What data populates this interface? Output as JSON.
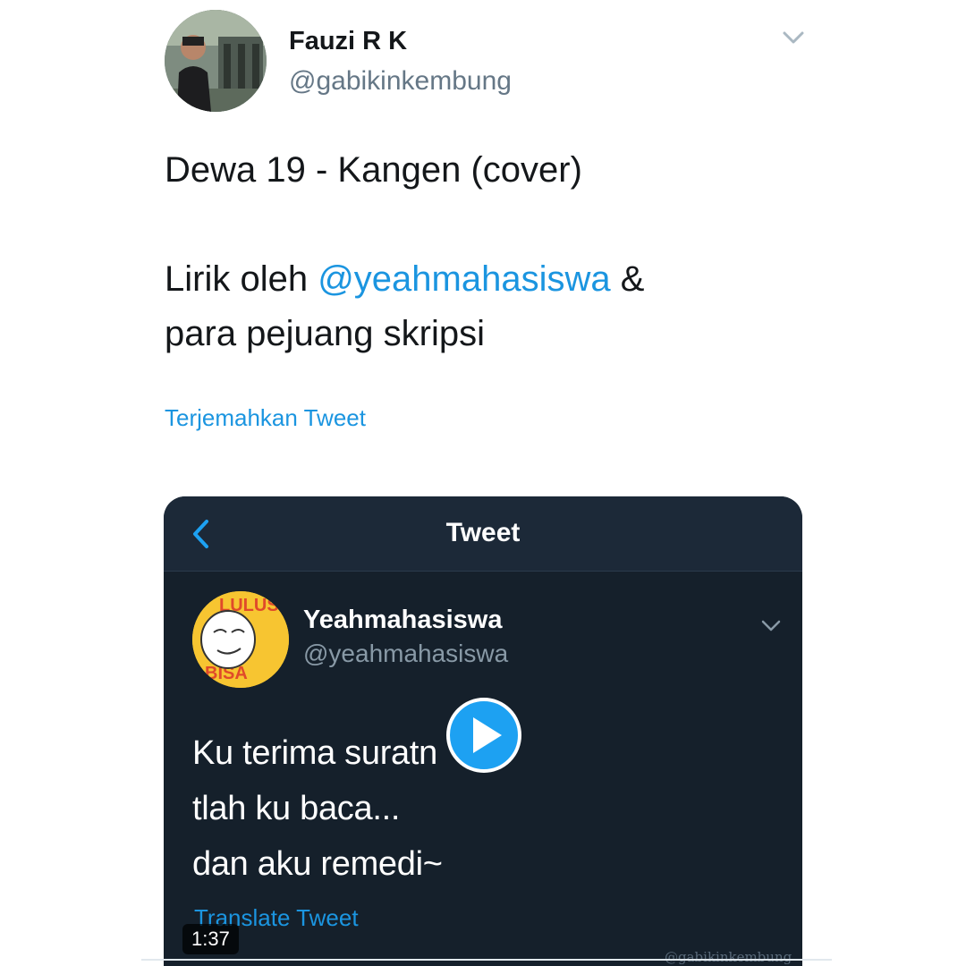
{
  "tweet": {
    "author": {
      "name": "Fauzi R K",
      "handle": "@gabikinkembung",
      "avatar_icon": "person-photo-avatar"
    },
    "menu_icon": "chevron-down-icon",
    "text": {
      "line1": "Dewa 19 - Kangen (cover)",
      "line2_prefix": "Lirik oleh ",
      "line2_mention": "@yeahmahasiswa",
      "line2_suffix": " &",
      "line3": "para pejuang skripsi"
    },
    "translate_label": "Terjemahkan Tweet",
    "accent_color": "#1b95e0"
  },
  "media": {
    "header_title": "Tweet",
    "back_icon": "chevron-left-icon",
    "embedded_tweet": {
      "name": "Yeahmahasiswa",
      "handle": "@yeahmahasiswa",
      "avatar_icon": "meme-face-avatar",
      "lines": [
        "Ku terima suratn",
        "tlah ku baca...",
        "dan aku remedi~"
      ],
      "translate_label": "Translate Tweet"
    },
    "play_icon": "play-icon",
    "duration": "1:37",
    "watermark": "@gabikinkembung",
    "background_color": "#15202b"
  }
}
